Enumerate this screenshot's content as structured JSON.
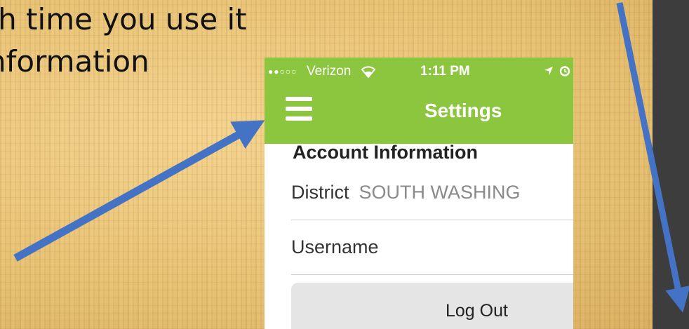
{
  "slide": {
    "line1": "ch time you use it",
    "line2": "nformation"
  },
  "phone": {
    "status_bar": {
      "signal": "●●○○○",
      "carrier": "Verizon",
      "time": "1:11 PM"
    },
    "nav": {
      "title": "Settings",
      "menu_icon": "hamburger-icon"
    },
    "section_header": "Account Information",
    "rows": [
      {
        "label": "District",
        "value": "SOUTH WASHING"
      },
      {
        "label": "Username",
        "value": ""
      }
    ],
    "logout_label": "Log Out"
  },
  "colors": {
    "nav_green": "#8cc63f",
    "arrow_blue": "#4472c4",
    "panel_dark": "#3d3d3d"
  }
}
